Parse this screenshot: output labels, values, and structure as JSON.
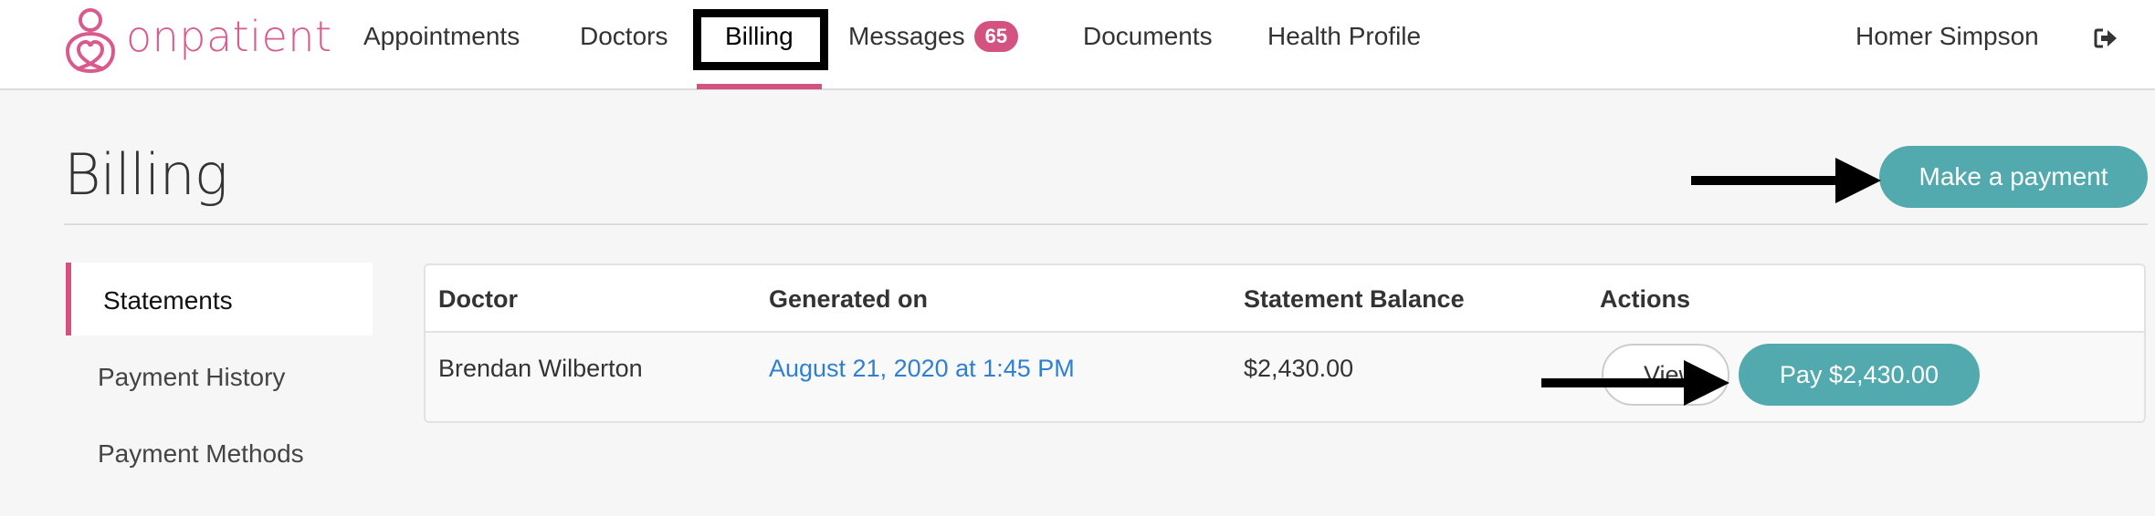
{
  "app": {
    "brand_name": "onpatient",
    "brand_color": "#d95b8d",
    "accent_color": "#52a9ae"
  },
  "nav": {
    "items": [
      {
        "label": "Appointments"
      },
      {
        "label": "Doctors"
      },
      {
        "label": "Billing",
        "active": true
      },
      {
        "label": "Messages",
        "badge": "65"
      },
      {
        "label": "Documents"
      },
      {
        "label": "Health Profile"
      }
    ],
    "user_name": "Homer Simpson",
    "logout_icon": "sign-out-icon"
  },
  "page": {
    "title": "Billing",
    "make_payment_label": "Make a payment"
  },
  "sidebar": {
    "items": [
      {
        "label": "Statements",
        "active": true
      },
      {
        "label": "Payment History"
      },
      {
        "label": "Payment Methods"
      }
    ]
  },
  "statements_table": {
    "columns": [
      "Doctor",
      "Generated on",
      "Statement Balance",
      "Actions"
    ],
    "rows": [
      {
        "doctor": "Brendan Wilberton",
        "generated_on": "August 21, 2020 at 1:45 PM",
        "balance": "$2,430.00",
        "view_label": "View",
        "pay_label": "Pay $2,430.00"
      }
    ]
  }
}
